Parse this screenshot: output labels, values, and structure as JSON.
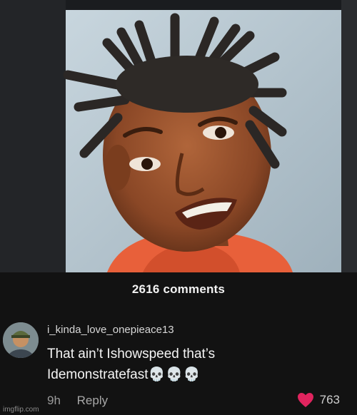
{
  "header": {
    "comment_count": "2616 comments"
  },
  "comment": {
    "username": "i_kinda_love_onepieace13",
    "text_line1": "That ain’t Ishowspeed that’s",
    "text_line2": "Idemonstratefast",
    "emoji": "💀💀💀",
    "age": "9h",
    "reply_label": "Reply",
    "like_count": "763"
  },
  "watermark": "imgflip.com",
  "icons": {
    "like": "heart-icon",
    "skull": "skull-emoji"
  },
  "colors": {
    "background": "#121212",
    "like_heart": "#e0245e"
  }
}
